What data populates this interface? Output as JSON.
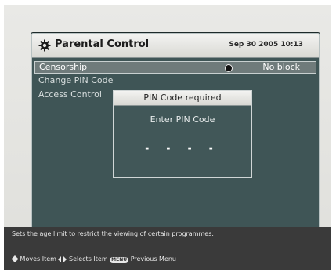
{
  "header": {
    "title": "Parental Control",
    "datetime": "Sep 30 2005 10:13",
    "icon": "gear-icon"
  },
  "menu": {
    "items": [
      {
        "label": "Censorship",
        "value": "No block"
      },
      {
        "label": "Change PIN Code"
      },
      {
        "label": "Access Control"
      }
    ]
  },
  "dialog": {
    "title": "PIN Code required",
    "prompt": "Enter PIN Code",
    "mask": "- - - -"
  },
  "footer": {
    "help": "Sets the age limit to restrict the viewing of certain programmes.",
    "moves_label": "Moves Item",
    "selects_label": "Selects Item",
    "menu_key": "MENU",
    "previous_label": "Previous Menu"
  },
  "colors": {
    "panel": "#3f5556",
    "header": "#e6e6e2",
    "selected": "#6f7b7b",
    "footer": "#3a3a3a"
  }
}
